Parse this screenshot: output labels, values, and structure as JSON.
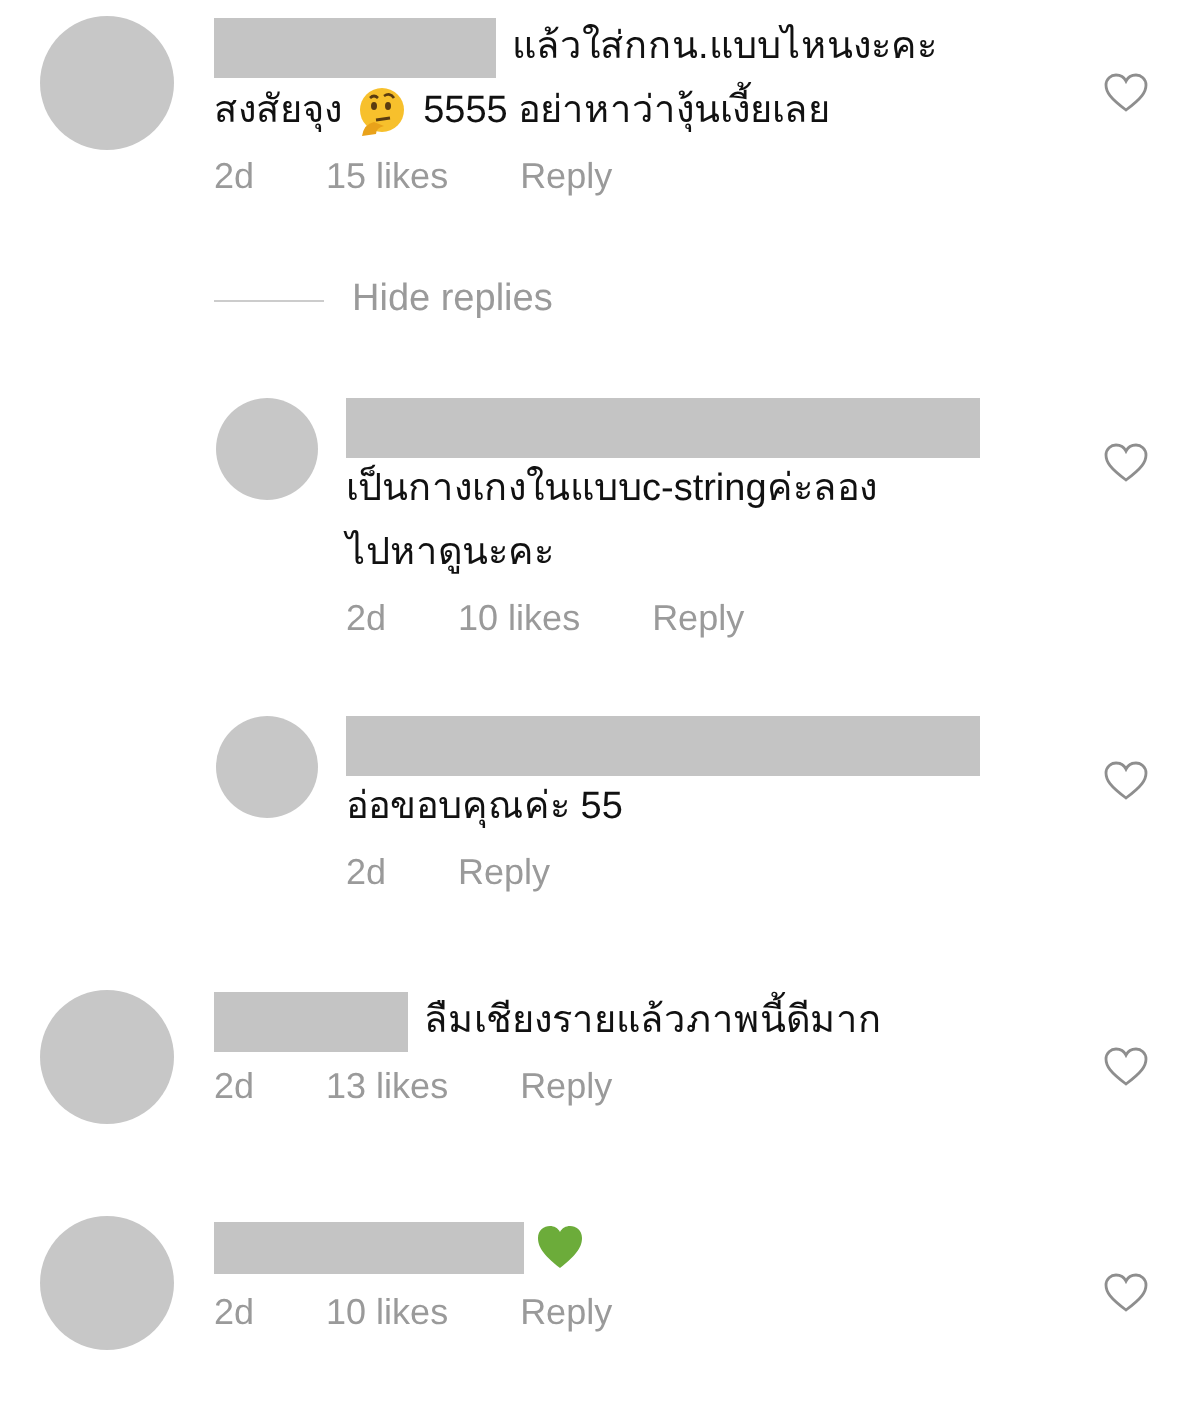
{
  "comments": [
    {
      "parts": [
        {
          "kind": "text",
          "text": "แล้วใส่กกน.แบบไหนงะคะ"
        },
        {
          "kind": "text",
          "text": "สงสัยจุง"
        },
        {
          "kind": "thinking-emoji"
        },
        {
          "kind": "text",
          "text": "5555 อย่าหาว่างุ้นเงี้ยเลย"
        }
      ],
      "time": "2d",
      "likes": "15 likes",
      "reply": "Reply",
      "liked": false,
      "replies_toggle": "Hide replies",
      "replies": [
        {
          "parts": [
            {
              "kind": "text",
              "text": "เป็นกางเกงในแบบc-stringค่ะลอง"
            },
            {
              "kind": "text",
              "text": "ไปหาดูนะคะ"
            }
          ],
          "time": "2d",
          "likes": "10 likes",
          "reply": "Reply",
          "liked": false
        },
        {
          "parts": [
            {
              "kind": "text",
              "text": "อ่อขอบคุณค่ะ 55"
            }
          ],
          "time": "2d",
          "reply": "Reply",
          "liked": false
        }
      ]
    },
    {
      "parts": [
        {
          "kind": "text",
          "text": "ลืมเชียงรายแล้วภาพนี้ดีมาก"
        }
      ],
      "time": "2d",
      "likes": "13 likes",
      "reply": "Reply",
      "liked": false
    },
    {
      "parts": [
        {
          "kind": "heart-emoji"
        }
      ],
      "time": "2d",
      "likes": "10 likes",
      "reply": "Reply",
      "liked": false
    }
  ]
}
